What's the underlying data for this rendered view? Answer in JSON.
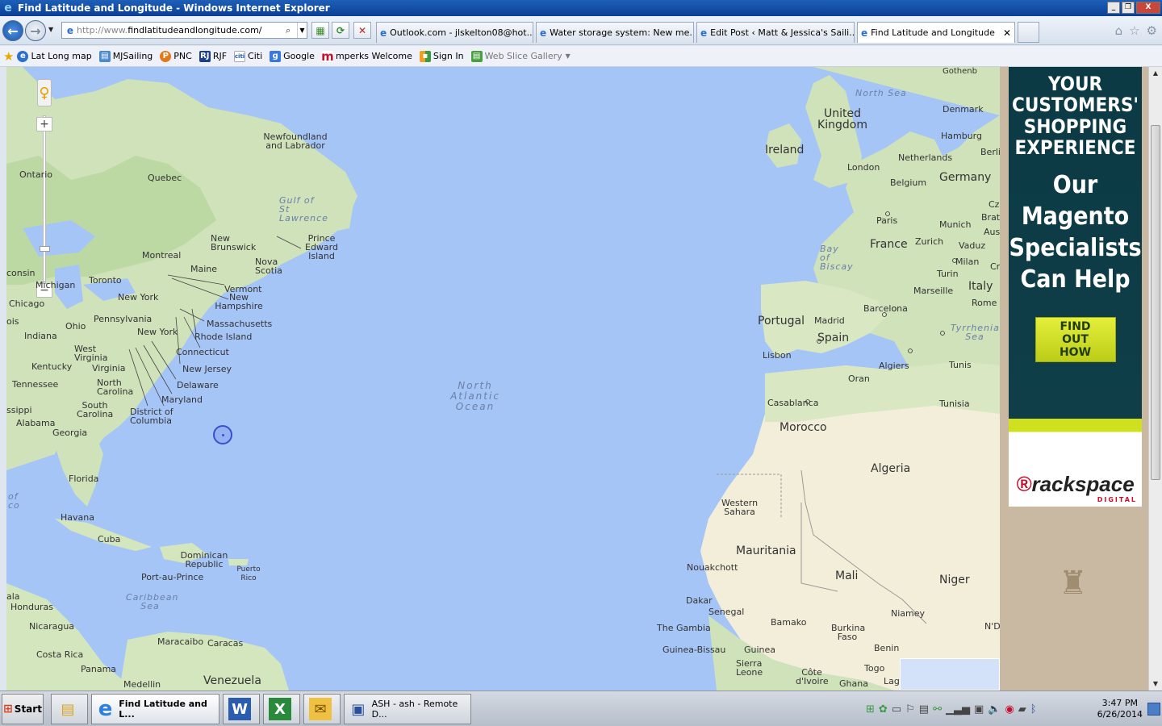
{
  "window": {
    "title": "Find Latitude and Longitude - Windows Internet Explorer",
    "controls": [
      "_",
      "❐",
      "X"
    ]
  },
  "address": {
    "url_prefix": "http://www.",
    "url_main": "findlatitudeandlongitude.com/"
  },
  "tabs": [
    {
      "label": "Outlook.com - jlskelton08@hot...",
      "active": false
    },
    {
      "label": "Water storage system: New me...",
      "active": false
    },
    {
      "label": "Edit Post ‹ Matt & Jessica's Saili...",
      "active": false
    },
    {
      "label": "Find Latitude and Longitude",
      "active": true
    }
  ],
  "favorites": [
    {
      "label": "Lat Long map",
      "icon": "ie-icon",
      "color": "#2a6fd0"
    },
    {
      "label": "MJSailing",
      "icon": "page-icon",
      "color": "#4a8ad0"
    },
    {
      "label": "PNC",
      "icon": "pnc-icon",
      "color": "#e07a1a"
    },
    {
      "label": "RJF",
      "icon": "rj-icon",
      "color": "#1a3f8c"
    },
    {
      "label": "Citi",
      "icon": "citi-icon",
      "color": "#1a5fb4"
    },
    {
      "label": "Google",
      "icon": "google-icon",
      "color": "#3a78e0"
    },
    {
      "label": "mperks Welcome",
      "icon": "mperks-icon",
      "color": "#c8102e"
    },
    {
      "label": "Sign In",
      "icon": "windows-icon",
      "color": "#f0a020"
    },
    {
      "label": "Web Slice Gallery",
      "icon": "slice-icon",
      "color": "#4aa040"
    }
  ],
  "map": {
    "labels": {
      "newfoundland": "Newfoundland and Labrador",
      "quebec": "Quebec",
      "ontario": "Ontario",
      "gulf": "Gulf of St Lawrence",
      "new_brunswick": "New Brunswick",
      "pei": "Prince Edward Island",
      "nova_scotia": "Nova Scotia",
      "montreal": "Montreal",
      "maine": "Maine",
      "toronto": "Toronto",
      "michigan": "Michigan",
      "wisconsin": "consin",
      "chicago": "Chicago",
      "illinois": "ois",
      "new_york_state": "New York",
      "vermont": "Vermont",
      "new_hampshire": "New Hampshire",
      "pennsylvania": "Pennsylvania",
      "ohio": "Ohio",
      "indiana": "Indiana",
      "new_york_city": "New York",
      "massachusetts": "Massachusetts",
      "rhode_island": "Rhode Island",
      "connecticut": "Connecticut",
      "west_virginia": "West Virginia",
      "virginia": "Virginia",
      "new_jersey": "New Jersey",
      "kentucky": "Kentucky",
      "delaware": "Delaware",
      "tennessee": "Tennessee",
      "north_carolina": "North Carolina",
      "maryland": "Maryland",
      "south_carolina": "South Carolina",
      "dc": "District of Columbia",
      "mississippi": "ssippi",
      "alabama": "Alabama",
      "georgia": "Georgia",
      "florida": "Florida",
      "gulf_mexico": "of co",
      "havana": "Havana",
      "cuba": "Cuba",
      "dominican": "Dominican Republic",
      "puerto_rico": "Puerto Rico",
      "port_au_prince": "Port-au-Prince",
      "guatemala": "ala",
      "honduras": "Honduras",
      "caribbean": "Caribbean Sea",
      "nicaragua": "Nicaragua",
      "maracaibo": "Maracaibo",
      "caracas": "Caracas",
      "costa_rica": "Costa Rica",
      "panama": "Panama",
      "medellin": "Medellin",
      "venezuela": "Venezuela",
      "ocean": "North Atlantic Ocean",
      "north_sea": "North Sea",
      "uk": "United Kingdom",
      "denmark": "Denmark",
      "hamburg": "Hamburg",
      "ireland": "Ireland",
      "berlin": "Berli",
      "netherlands": "Netherlands",
      "london": "London",
      "belgium": "Belgium",
      "germany": "Germany",
      "czech": "Cz",
      "paris": "Paris",
      "munich": "Munich",
      "bratislava": "Brat",
      "austria": "Aus",
      "bay_biscay": "Bay of Biscay",
      "france": "France",
      "zurich": "Zurich",
      "vaduz": "Vaduz",
      "milan": "Milan",
      "croatia": "Cr",
      "turin": "Turin",
      "marseille": "Marseille",
      "italy": "Italy",
      "rome": "Rome",
      "barcelona": "Barcelona",
      "portugal": "Portugal",
      "madrid": "Madrid",
      "spain": "Spain",
      "tyrrhenian": "Tyrrhenian Sea",
      "lisbon": "Lisbon",
      "algiers": "Algiers",
      "tunis": "Tunis",
      "oran": "Oran",
      "casablanca": "Casablanca",
      "tunisia": "Tunisia",
      "morocco": "Morocco",
      "algeria": "Algeria",
      "western_sahara": "Western Sahara",
      "mauritania": "Mauritania",
      "nouakchott": "Nouakchott",
      "mali": "Mali",
      "niger": "Niger",
      "dakar": "Dakar",
      "senegal": "Senegal",
      "bamako": "Bamako",
      "niamey": "Niamey",
      "the_gambia": "The Gambia",
      "burkina": "Burkina Faso",
      "ndjamena": "N'D",
      "guinea_bissau": "Guinea-Bissau",
      "guinea": "Guinea",
      "benin": "Benin",
      "sierra_leone": "Sierra Leone",
      "cote": "Côte d'Ivoire",
      "togo": "Togo",
      "ghana": "Ghana",
      "lagos": "Lag",
      "gothenburg": "Gothenb"
    }
  },
  "ad": {
    "lines_top": [
      "YOUR",
      "CUSTOMERS'",
      "SHOPPING",
      "EXPERIENCE"
    ],
    "lines_mid": [
      "Our",
      "Magento",
      "Specialists",
      "Can Help"
    ],
    "cta": "FIND OUT HOW",
    "brand": "rackspace",
    "brand_sub": "DIGITAL"
  },
  "taskbar": {
    "start": "Start",
    "buttons": [
      {
        "label": "",
        "icon": "folder-icon"
      },
      {
        "label": "Find Latitude and L...",
        "icon": "ie-icon",
        "active": true
      },
      {
        "label": "",
        "icon": "word-icon"
      },
      {
        "label": "",
        "icon": "excel-icon"
      },
      {
        "label": "",
        "icon": "outlook-icon"
      },
      {
        "label": "ASH - ash - Remote D...",
        "icon": "remote-desktop-icon"
      }
    ],
    "time": "3:47 PM",
    "date": "6/26/2014"
  }
}
